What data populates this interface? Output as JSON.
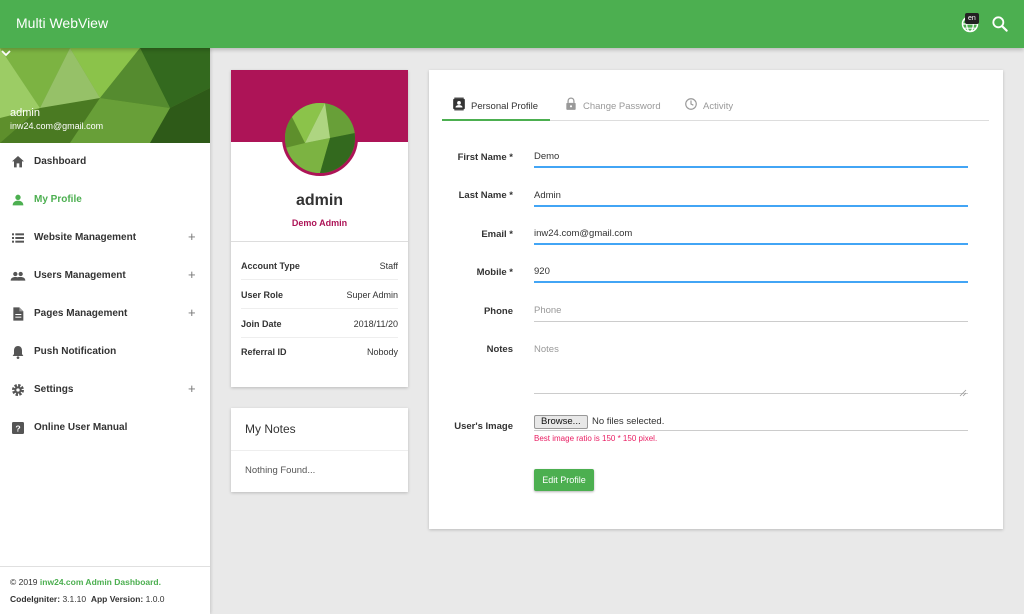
{
  "topbar": {
    "title": "Multi WebView",
    "lang_badge": "en",
    "icons": [
      "globe-icon",
      "search-icon"
    ]
  },
  "sidebar": {
    "user_name": "admin",
    "user_email": "inw24.com@gmail.com",
    "items": [
      {
        "label": "Dashboard",
        "icon": "home-icon",
        "expandable": false,
        "active": false
      },
      {
        "label": "My Profile",
        "icon": "person-icon",
        "expandable": false,
        "active": true
      },
      {
        "label": "Website Management",
        "icon": "list-icon",
        "expandable": true,
        "active": false
      },
      {
        "label": "Users Management",
        "icon": "people-icon",
        "expandable": true,
        "active": false
      },
      {
        "label": "Pages Management",
        "icon": "page-icon",
        "expandable": true,
        "active": false
      },
      {
        "label": "Push Notification",
        "icon": "bell-icon",
        "expandable": false,
        "active": false
      },
      {
        "label": "Settings",
        "icon": "gear-icon",
        "expandable": true,
        "active": false
      },
      {
        "label": "Online User Manual",
        "icon": "help-icon",
        "expandable": false,
        "active": false
      }
    ],
    "plus_symbol": "+",
    "footer": {
      "copyright": "© 2019",
      "brand": "inw24.com Admin Dashboard.",
      "ci_label": "CodeIgniter:",
      "ci_version": "3.1.10",
      "app_label": "App Version:",
      "app_version": "1.0.0"
    }
  },
  "profile": {
    "name": "admin",
    "role": "Demo Admin",
    "rows": [
      {
        "key": "Account Type",
        "value": "Staff"
      },
      {
        "key": "User Role",
        "value": "Super Admin"
      },
      {
        "key": "Join Date",
        "value": "2018/11/20"
      },
      {
        "key": "Referral ID",
        "value": "Nobody"
      }
    ]
  },
  "notes_card": {
    "title": "My Notes",
    "empty_text": "Nothing Found..."
  },
  "form": {
    "tabs": [
      {
        "label": "Personal Profile",
        "icon": "contact-card-icon",
        "active": true
      },
      {
        "label": "Change Password",
        "icon": "lock-icon",
        "active": false
      },
      {
        "label": "Activity",
        "icon": "clock-icon",
        "active": false
      }
    ],
    "fields": {
      "first_name": {
        "label": "First Name *",
        "value": "Demo"
      },
      "last_name": {
        "label": "Last Name *",
        "value": "Admin"
      },
      "email": {
        "label": "Email *",
        "value": "inw24.com@gmail.com"
      },
      "mobile": {
        "label": "Mobile *",
        "value": "920"
      },
      "phone": {
        "label": "Phone",
        "placeholder": "Phone"
      },
      "notes": {
        "label": "Notes",
        "placeholder": "Notes"
      }
    },
    "image": {
      "label": "User's Image",
      "browse_label": "Browse...",
      "file_status": "No files selected.",
      "hint": "Best image ratio is 150 * 150 pixel."
    },
    "submit_label": "Edit Profile"
  },
  "colors": {
    "primary": "#4caf50",
    "profile_accent": "#ad1457",
    "focus_underline": "#42a5f5",
    "hint": "#e91e63"
  }
}
